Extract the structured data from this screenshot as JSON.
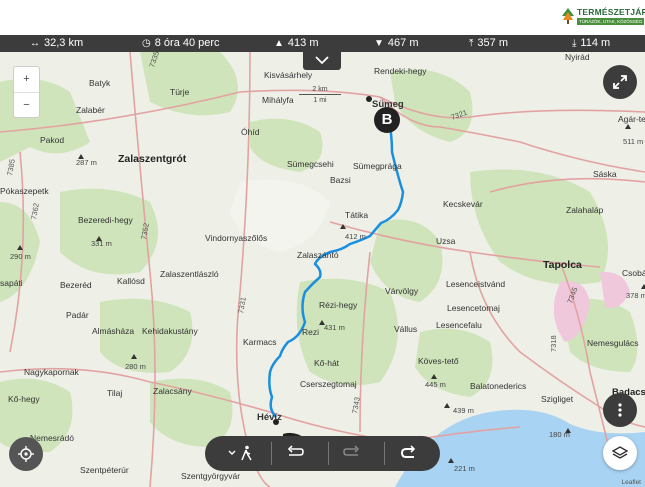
{
  "brand": {
    "name": "TERMÉSZETJÁRÓ",
    "tagline": "TÚRÁZÓK, UTAK, KÖZÖSSÉG"
  },
  "stats": {
    "distance": "32,3 km",
    "duration": "8 óra 40 perc",
    "ascent": "413 m",
    "descent": "467 m",
    "max_elevation": "357 m",
    "min_elevation": "114 m"
  },
  "scale": {
    "metric": "2 km",
    "imperial": "1 mi"
  },
  "zoom": {
    "in": "+",
    "out": "−"
  },
  "marker_end": {
    "label": "B"
  },
  "towns": {
    "kisvasarhely": "Kisvásárhely",
    "mihalyfa": "Mihályfa",
    "sumeg": "Sümeg",
    "rendeki_hegy": "Rendeki-hegy",
    "nyirad": "Nyirád",
    "batyk": "Batyk",
    "turje": "Türje",
    "zalaber": "Zalabér",
    "ohid": "Óhíd",
    "pakod": "Pakod",
    "zalaszentgrot": "Zalaszentgrót",
    "sumegcsehi": "Sümegcsehi",
    "sumegprada": "Sümegprága",
    "bazsi": "Bazsi",
    "pokaszepetk": "Pókaszepetk",
    "bezeredi_hegy": "Bezeredi-hegy",
    "tatika": "Tátika",
    "kecskevar": "Kecskevár",
    "saska": "Sáska",
    "zalahalap": "Zalahaláp",
    "agartető": "Agár-tető",
    "vindornyaszolos": "Vindornyaszőlős",
    "uzsa": "Uzsa",
    "zalaszanto": "Zalaszántó",
    "tapolca": "Tapolca",
    "sapati": "sapáti",
    "bezered": "Bezeréd",
    "kallosd": "Kallósd",
    "zalaszentlaszlo": "Zalaszentlászló",
    "lesenceistvand": "Lesenceistvánd",
    "varvolgy": "Várvölgy",
    "lesencetomaj": "Lesencetomaj",
    "csobanc": "Csobánc",
    "padar": "Padár",
    "almashaza": "Almásháza",
    "kehidakustany": "Kehidakustány",
    "rezi_hegy": "Rézi-hegy",
    "vallus": "Vállus",
    "lesencefalu": "Lesencefalu",
    "rezi": "Rezi",
    "nemesgulacs": "Nemesgulács",
    "karmacs": "Karmacs",
    "ko_hat": "Kő-hát",
    "koves_teto": "Köves-tető",
    "nagykapornak": "Nagykapornak",
    "cserszegtomaj": "Cserszegtomaj",
    "balatonederics": "Balatonederics",
    "badacsony": "Badacsony",
    "tilaj": "Tilaj",
    "zalacsany": "Zalacsány",
    "ko_hegy": "Kő-hegy",
    "szigliget": "Szigliget",
    "heviz": "Hévíz",
    "nemesrado": "Nemesrádó",
    "szentpeterur": "Szentpéterúr",
    "szentgyorgyvar": "Szentgyörgyvár"
  },
  "roads": {
    "r7335": "7335",
    "r7321": "7321",
    "r7385": "7385",
    "r7362": "7362",
    "r7352": "7352",
    "r7331": "7331",
    "r7345": "7345",
    "r7318": "7318",
    "r7343": "7343"
  },
  "peaks": {
    "p287": "287 m",
    "p511": "511 m",
    "p331": "331 m",
    "p290": "290 m",
    "p412": "412 m",
    "p378": "378 m",
    "p431": "431 m",
    "p280": "280 m",
    "p445": "445 m",
    "p439": "439 m",
    "p180": "180 m",
    "p221": "221 m"
  },
  "attribution": "Leaflet",
  "colors": {
    "route": "#1a8fe0",
    "bar": "#3c3c3c",
    "water": "#a9d3f2",
    "forest": "#cfe4bb",
    "road": "#e3a2a2"
  }
}
